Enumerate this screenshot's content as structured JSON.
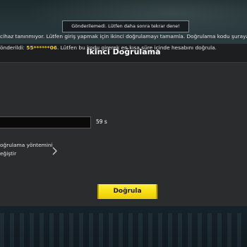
{
  "toast": {
    "message": "Gönderilemedi. Lütfen daha sonra tekrar dene!"
  },
  "dialog": {
    "title": "İkinci Doğrulama",
    "description_line1": "cihaz tanınmıyor. Lütfen giriş yapmak için ikinci doğrulamayı tamamla. Doğrulama kodu şuraya",
    "description_line2_prefix": "önderildi: ",
    "phone_masked": "55******06",
    "description_line2_suffix": ". Lütfen bu kodu girerek en kısa süre içinde hesabını doğrula.",
    "code_input_value": "",
    "countdown": "59 s",
    "change_method_line1": "oğrulama yöntemini",
    "change_method_line2": "eğiştir",
    "verify_button_label": "Doğrula"
  },
  "colors": {
    "accent_yellow": "#f7dd12",
    "phone_highlight": "#f5c518",
    "dialog_bg": "#2a2c2e",
    "header_bg": "#1c1e20"
  },
  "icons": {
    "change_method_chevron": "chevron-right-icon"
  }
}
